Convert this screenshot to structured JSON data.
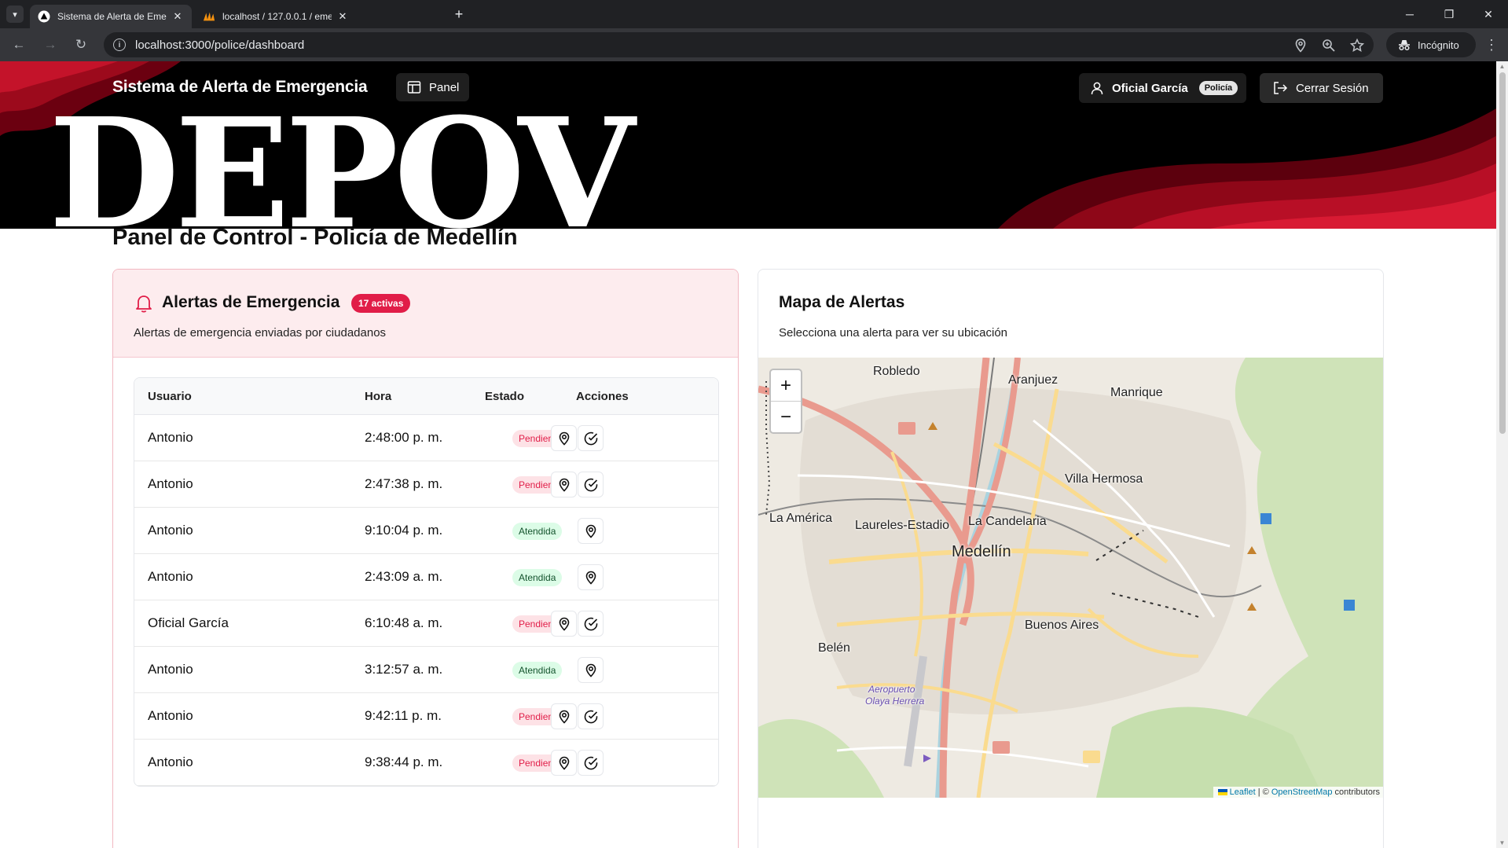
{
  "browser": {
    "tabs": [
      {
        "title": "Sistema de Alerta de Emergencia",
        "active": true
      },
      {
        "title": "localhost / 127.0.0.1 / emergencia",
        "active": false
      }
    ],
    "url": "localhost:3000/police/dashboard",
    "incognito_label": "Incógnito"
  },
  "header": {
    "brand": "Sistema de Alerta de Emergencia",
    "panel_button": "Panel",
    "banner_text": "DEPOV",
    "user_name": "Oficial García",
    "user_role": "Policía",
    "logout": "Cerrar Sesión"
  },
  "page": {
    "title": "Panel de Control - Policía de Medellín"
  },
  "alerts": {
    "title": "Alertas de Emergencia",
    "badge": "17 activas",
    "description": "Alertas de emergencia enviadas por ciudadanos",
    "columns": [
      "Usuario",
      "Hora",
      "Estado",
      "Acciones"
    ],
    "rows": [
      {
        "user": "Antonio",
        "time": "2:48:00 p. m.",
        "status": "Pendiente"
      },
      {
        "user": "Antonio",
        "time": "2:47:38 p. m.",
        "status": "Pendiente"
      },
      {
        "user": "Antonio",
        "time": "9:10:04 p. m.",
        "status": "Atendida"
      },
      {
        "user": "Antonio",
        "time": "2:43:09 a. m.",
        "status": "Atendida"
      },
      {
        "user": "Oficial García",
        "time": "6:10:48 a. m.",
        "status": "Pendiente"
      },
      {
        "user": "Antonio",
        "time": "3:12:57 a. m.",
        "status": "Atendida"
      },
      {
        "user": "Antonio",
        "time": "9:42:11 p. m.",
        "status": "Pendiente"
      },
      {
        "user": "Antonio",
        "time": "9:38:44 p. m.",
        "status": "Pendiente"
      }
    ],
    "colors": {
      "pending": "#e11d48",
      "attended": "#14532d",
      "badge": "#e11d48"
    }
  },
  "map": {
    "title": "Mapa de Alertas",
    "description": "Selecciona una alerta para ver su ubicación",
    "zoom_in": "+",
    "zoom_out": "−",
    "labels": {
      "robledo": "Robledo",
      "aranjuez": "Aranjuez",
      "manrique": "Manrique",
      "villa_hermosa": "Villa Hermosa",
      "la_america": "La América",
      "laureles": "Laureles-Estadio",
      "la_candelaria": "La Candelaria",
      "medellin": "Medellín",
      "buenos_aires": "Buenos Aires",
      "belen": "Belén",
      "aeropuerto": "Aeropuerto",
      "olaya": "Olaya Herrera"
    },
    "attribution": {
      "leaflet": "Leaflet",
      "sep": " | © ",
      "osm": "OpenStreetMap",
      "suffix": " contributors"
    }
  }
}
